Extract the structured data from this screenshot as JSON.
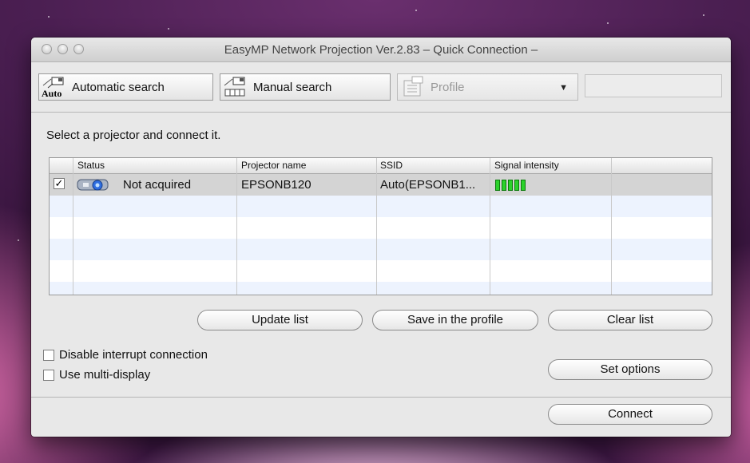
{
  "window": {
    "title": "EasyMP Network Projection Ver.2.83  – Quick Connection –"
  },
  "toolbar": {
    "auto_icon_label": "Auto",
    "automatic_search": "Automatic search",
    "manual_search": "Manual search",
    "profile": "Profile",
    "profile_arrow": "▼"
  },
  "instruction": "Select a projector and connect it.",
  "table": {
    "columns": [
      "Status",
      "Projector name",
      "SSID",
      "Signal intensity"
    ],
    "rows": [
      {
        "checked": true,
        "check_glyph": "✓",
        "status": "Not acquired",
        "projector_name": "EPSONB120",
        "ssid": "Auto(EPSONB1...",
        "signal_bars": 5
      }
    ]
  },
  "buttons": {
    "update_list": "Update list",
    "save_profile": "Save in the profile",
    "clear_list": "Clear list",
    "set_options": "Set options",
    "connect": "Connect"
  },
  "options": {
    "disable_interrupt": "Disable interrupt connection",
    "multi_display": "Use multi-display"
  },
  "colors": {
    "signal_green": "#2bd22b",
    "selected_row": "#d4d4d4",
    "alt_row": "#edf3fe"
  }
}
